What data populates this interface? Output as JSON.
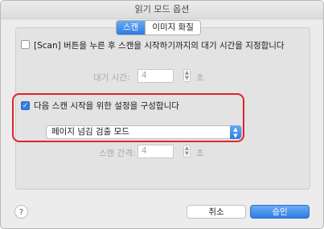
{
  "window": {
    "title": "읽기 모드 옵션"
  },
  "tabs": [
    {
      "label": "스캔",
      "active": true
    },
    {
      "label": "이미지 화질",
      "active": false
    }
  ],
  "options": {
    "wait_checkbox": {
      "label": "[Scan] 버튼을 누른 후 스캔을 시작하기까지의 대기 시간을 지정합니다",
      "checked": false
    },
    "wait_time": {
      "label": "대기 시간:",
      "value": "4",
      "unit": "초"
    },
    "next_scan_checkbox": {
      "label": "다음 스캔 시작을 위한 설정을 구성합니다",
      "checked": true
    },
    "mode_select": {
      "value": "페이지 넘김 검출 모드"
    },
    "scan_interval": {
      "label": "스캔 간격:",
      "value": "4",
      "unit": "초"
    }
  },
  "footer": {
    "help": "?",
    "cancel_label": "취소",
    "ok_label": "승인"
  },
  "colors": {
    "accent": "#2f7de2",
    "highlight": "#e0232e"
  }
}
